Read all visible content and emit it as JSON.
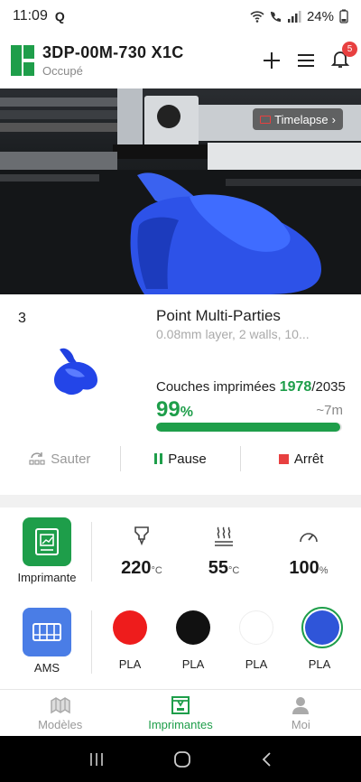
{
  "status_bar": {
    "time": "11:09",
    "q_badge": "Q",
    "battery": "24%",
    "icons": [
      "wifi-icon",
      "call-icon",
      "signal-icon",
      "battery-icon"
    ]
  },
  "header": {
    "title": "3DP-00M-730 X1C",
    "status": "Occupé",
    "notification_count": "5",
    "accent": "#1e9e4a"
  },
  "camera": {
    "timelapse_label": "Timelapse",
    "timelapse_chevron": "›"
  },
  "job": {
    "plate": "3",
    "name": "Point Multi-Parties",
    "detail": "0.08mm layer, 2 walls, 10...",
    "layers_label": "Couches imprimées",
    "layer_current": "1978",
    "layer_total": "/2035",
    "percent": "99",
    "percent_unit": "%",
    "progress_fraction": 0.99,
    "remaining": "~7m",
    "controls": {
      "skip": "Sauter",
      "pause": "Pause",
      "stop": "Arrêt"
    }
  },
  "status": {
    "printer_label": "Imprimante",
    "ams_label": "AMS",
    "nozzle_temp": "220",
    "bed_temp": "55",
    "temp_unit": "°C",
    "fan_speed": "100",
    "fan_unit": "%"
  },
  "ams": {
    "slots": [
      {
        "label": "PLA",
        "color": "#ee1c1c",
        "selected": false
      },
      {
        "label": "PLA",
        "color": "#111111",
        "selected": false
      },
      {
        "label": "PLA",
        "color": "#ffffff",
        "selected": false
      },
      {
        "label": "PLA",
        "color": "#2f55d9",
        "selected": true
      }
    ]
  },
  "nav": {
    "models": "Modèles",
    "printers": "Imprimantes",
    "me": "Moi"
  }
}
